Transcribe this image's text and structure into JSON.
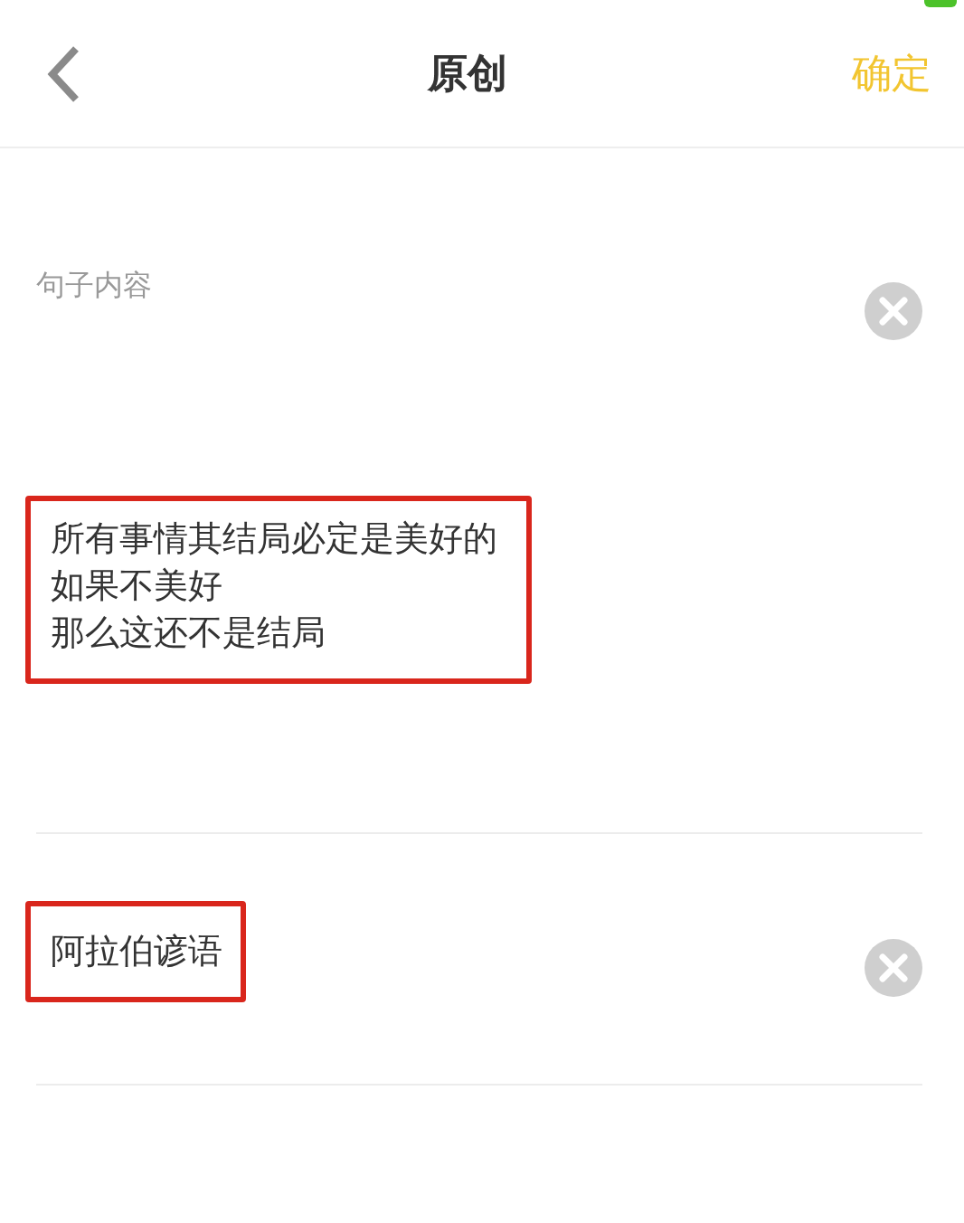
{
  "header": {
    "title": "原创",
    "confirm": "确定"
  },
  "fields": [
    {
      "label": "句子内容",
      "lines": [
        "所有事情其结局必定是美好的",
        "如果不美好",
        "那么这还不是结局"
      ],
      "highlighted": true
    },
    {
      "lines": [
        "阿拉伯谚语"
      ],
      "highlighted": true
    }
  ]
}
